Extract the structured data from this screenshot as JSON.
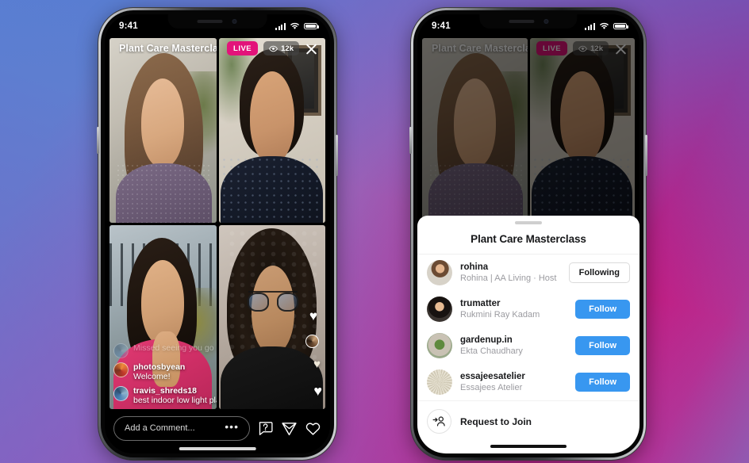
{
  "background": {
    "gradient_from": "#5c7ed1",
    "gradient_mid": "#9a5fb6",
    "gradient_to": "#c4187f"
  },
  "phones": {
    "left": {
      "status_bar": {
        "clock": "9:41",
        "signal_icon": "signal-bars-icon",
        "wifi_icon": "wifi-icon",
        "battery_icon": "battery-icon"
      },
      "live": {
        "title": "Plant Care Mastercla...",
        "live_badge": "LIVE",
        "viewer_count": "12k",
        "viewer_icon": "eye-icon",
        "close_icon": "close-icon",
        "accent_live": "#e3137a"
      },
      "comments": [
        {
          "user": "",
          "message": "Missed seeing you go Live...",
          "faded": true
        },
        {
          "user": "photosbyean",
          "message": "Welcome!",
          "faded": false
        },
        {
          "user": "travis_shreds18",
          "message": "best indoor low light plan to maintain?",
          "faded": false
        }
      ],
      "action_bar": {
        "comment_placeholder": "Add a Comment...",
        "more_label": "•••",
        "icons": [
          "question-bubble-icon",
          "send-icon",
          "heart-icon"
        ]
      }
    },
    "right": {
      "status_bar": {
        "clock": "9:41",
        "signal_icon": "signal-bars-icon",
        "wifi_icon": "wifi-icon",
        "battery_icon": "battery-icon"
      },
      "live": {
        "title": "Plant Care Mastercla...",
        "live_badge": "LIVE",
        "viewer_count": "12k",
        "viewer_icon": "eye-icon",
        "close_icon": "close-icon"
      },
      "sheet": {
        "title": "Plant Care Masterclass",
        "follow_accent": "#3897f0",
        "users": [
          {
            "username": "rohina",
            "fullname": "Rohina | AA Living · Host",
            "action": "Following",
            "state": "following"
          },
          {
            "username": "trumatter",
            "fullname": "Rukmini Ray Kadam",
            "action": "Follow",
            "state": "follow"
          },
          {
            "username": "gardenup.in",
            "fullname": "Ekta Chaudhary",
            "action": "Follow",
            "state": "follow"
          },
          {
            "username": "essajeesatelier",
            "fullname": "Essajees Atelier",
            "action": "Follow",
            "state": "follow"
          }
        ],
        "request_to_join": {
          "label": "Request to Join",
          "icon": "add-person-icon"
        }
      }
    }
  }
}
